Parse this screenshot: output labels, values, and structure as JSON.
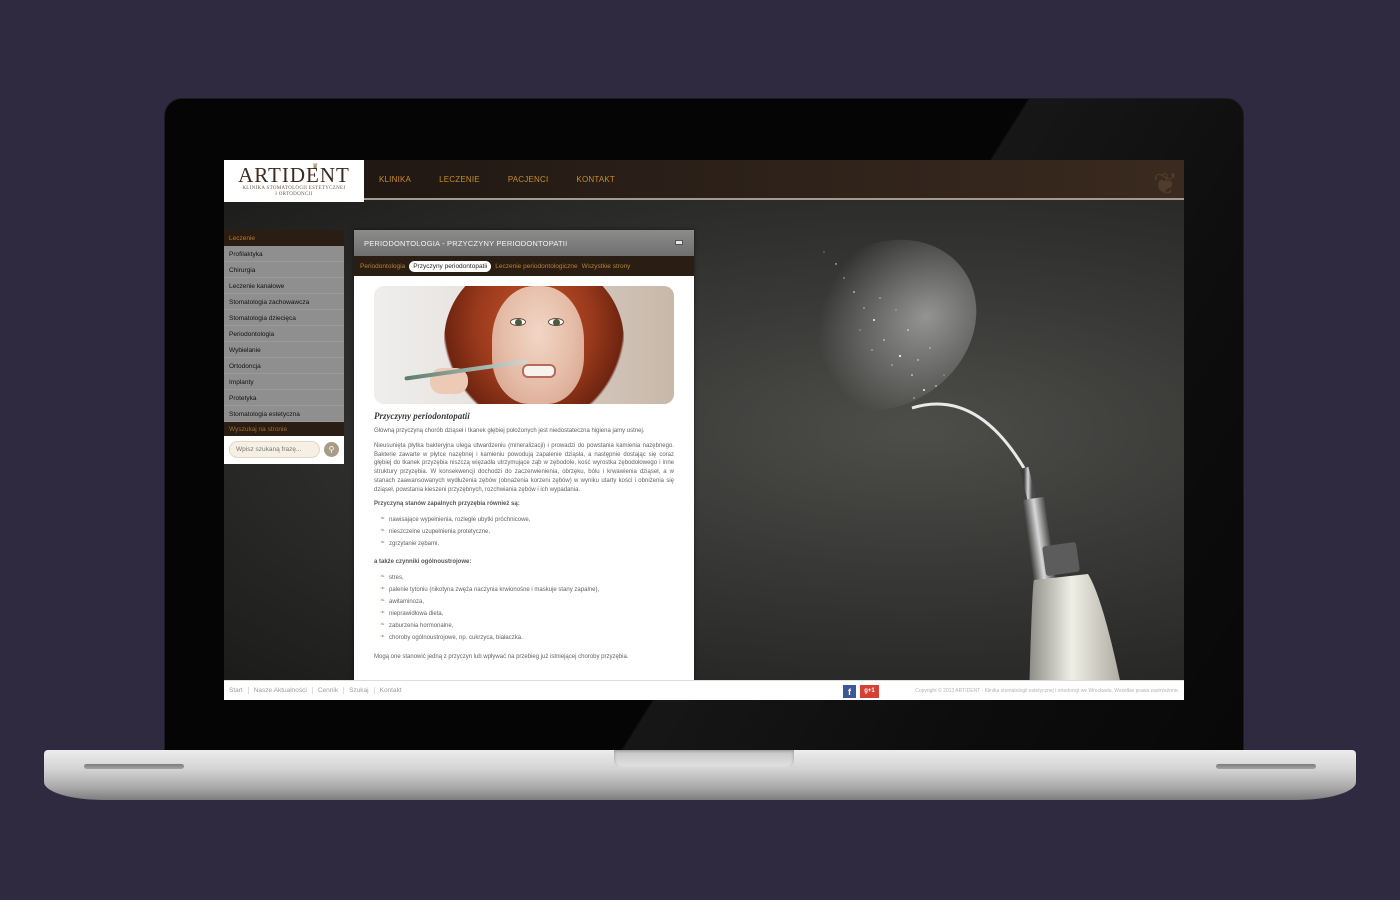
{
  "site": {
    "logo_text": "ARTIDENT",
    "logo_sub1": "KLINIKA STOMATOLOGII ESTETYCZNEJ",
    "logo_sub2": "I ORTODONCJI"
  },
  "nav": {
    "items": [
      "KLINIKA",
      "LECZENIE",
      "PACJENCI",
      "KONTAKT"
    ]
  },
  "sidebar": {
    "heading": "Leczenie",
    "items": [
      "Profilaktyka",
      "Chirurgia",
      "Leczenie kanałowe",
      "Stomatologia zachowawcza",
      "Stomatologia dziecięca",
      "Periodontologia",
      "Wybielanie",
      "Ortodoncja",
      "Implanty",
      "Protetyka",
      "Stomatologia estetyczna"
    ],
    "search_heading": "Wyszukaj na stronie",
    "search_placeholder": "Wpisz szukaną frazę..."
  },
  "panel": {
    "title": "PERIODONTOLOGIA - PRZYCZYNY PERIODONTOPATII",
    "subnav": [
      "Periodontologia",
      "Przyczyny periodontopatii",
      "Leczenie periodontologiczne",
      "Wszystkie strony"
    ],
    "subnav_active": 1,
    "article_title": "Przyczyny periodontopatii",
    "para1": "Główną przyczyną chorób dziąseł i tkanek głębiej położonych jest niedostateczna higiena jamy ustnej.",
    "para2": "Nieusunięta płytka bakteryjna ulega utwardzeniu (mineralizacji) i prowadzi do powstania kamienia nazębnego. Bakterie zawarte w płytce nazębnej i kamieniu powodują zapalenie dziąsła, a następnie dostając się coraz głębiej do tkanek przyzębia niszczą więzadła utrzymujące ząb w zębodole, kość wyrostka zębodołowego i inne struktury przyzębia. W konsekwencji dochodzi do zaczerwienienia, obrzęku, bólu i krwawienia dziąseł, a w stanach zaawansowanych wydłużenia zębów (obnażenia korzeni zębów) w wyniku utarty kości i obniżenia się dziąseł, powstania kieszeni przyzębnych, rozchwiania zębów i ich wypadania.",
    "strong1": "Przyczyną stanów zapalnych przyzębia również są:",
    "list1": [
      "nawisające wypełnienia, rozległe ubytki próchnicowe,",
      "nieszczelne uzupełnienia protetyczne,",
      "zgrzytanie zębami,"
    ],
    "strong2": "a także czynniki ogólnoustrojowe:",
    "list2": [
      "stres,",
      "palenie tytoniu (nikotyna zwęża naczynia krwionośne i maskuje stany zapalne),",
      "awitaminoza,",
      "nieprawidłowa dieta,",
      "zaburzenia hormonalne,",
      "choroby ogólnoustrojowe, np. cukrzyca, białaczka."
    ],
    "para3": "Mogą one stanowić jedną z przyczyn lub wpływać na przebieg już istniejącej choroby przyzębia."
  },
  "footer": {
    "links": [
      "Start",
      "Nasze Aktualności",
      "Cennik",
      "Szukaj",
      "Kontakt"
    ],
    "facebook": "f",
    "gplus": "g+1",
    "copyright": "Copyright © 2013 ARTIDENT - Klinika stomatologii estetycznej i ortodoncji we Wrocławiu. Wszelkie prawa zastrzeżone."
  },
  "colors": {
    "accent": "#c88a2c",
    "header_dark": "#2a1d14",
    "background": "#302a41"
  }
}
